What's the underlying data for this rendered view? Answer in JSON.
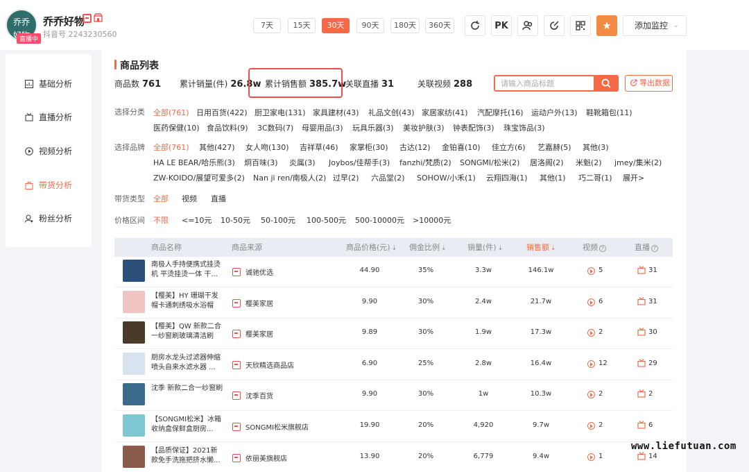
{
  "account": {
    "avatar_line1": "乔乔",
    "avatar_line2": "好物",
    "live_badge": "直播中",
    "name": "乔乔好物",
    "store_icon": "store-icon",
    "id_text": "抖音号 2243230560"
  },
  "time_ranges": [
    {
      "label": "7天",
      "active": false
    },
    {
      "label": "15天",
      "active": false
    },
    {
      "label": "30天",
      "active": true
    },
    {
      "label": "90天",
      "active": false
    },
    {
      "label": "180天",
      "active": false
    },
    {
      "label": "360天",
      "active": false
    }
  ],
  "toolbar": {
    "pk_label": "PK",
    "add_monitor_label": "添加监控",
    "icons": [
      "refresh-icon",
      "pk-icon",
      "users-icon",
      "edit-icon",
      "qrcode-icon",
      "star-icon"
    ]
  },
  "sidebar": {
    "items": [
      {
        "label": "基础分析",
        "icon": "chart-icon",
        "active": false
      },
      {
        "label": "直播分析",
        "icon": "live-icon",
        "active": false
      },
      {
        "label": "视频分析",
        "icon": "video-icon",
        "active": false
      },
      {
        "label": "带货分析",
        "icon": "bag-icon",
        "active": true
      },
      {
        "label": "粉丝分析",
        "icon": "fans-icon",
        "active": false
      }
    ]
  },
  "section": {
    "title": "商品列表"
  },
  "stats": {
    "product_count_label": "商品数",
    "product_count": "761",
    "sales_label": "累计销量(件)",
    "sales": "26.8w",
    "revenue_label": "累计销售额",
    "revenue": "385.7w",
    "live_label": "关联直播",
    "live": "31",
    "video_label": "关联视频",
    "video": "288"
  },
  "search": {
    "placeholder": "请输入商品标题"
  },
  "export_label": "导出数据",
  "filters": {
    "category_label": "选择分类",
    "categories_row1": [
      "全部(761)",
      "日用百货(422)",
      "厨卫家电(131)",
      "家具建材(43)",
      "礼品文创(43)",
      "家居家纺(41)",
      "汽配摩托(16)",
      "运动户外(13)",
      "鞋靴箱包(11)"
    ],
    "categories_row2": [
      "医药保健(10)",
      "食品饮料(9)",
      "3C数码(7)",
      "母婴用品(3)",
      "玩具乐器(3)",
      "美妆护肤(3)",
      "钟表配饰(3)",
      "珠宝饰品(3)"
    ],
    "brand_label": "选择品牌",
    "brands_row1": [
      "全部(761)",
      "其他(427)",
      "女人吻(130)",
      "吉祥草(46)",
      "家掌柜(30)",
      "古达(12)",
      "金铂喜(10)",
      "佳立方(6)",
      "艺嘉赫(5)",
      "其他(3)"
    ],
    "brands_row2": [
      "HA LE BEAR/哈乐熊(3)",
      "炯百味(3)",
      "炎属(3)",
      "Joybos/佳帮手(3)",
      "fanzhi/梵质(2)",
      "SONGMI/松米(2)",
      "居洛阁(2)",
      "米魁(2)",
      "jmey/集米(2)"
    ],
    "brands_row3": [
      "ZW-KOIDO/展望可爱多(2)",
      "Nan ji ren/南极人(2)",
      "过早(2)",
      "六品堂(2)",
      "SOHOW/小禾(1)",
      "云翔四海(1)",
      "其他(1)",
      "巧二哥(1)",
      "展开>"
    ],
    "type_label": "带货类型",
    "types": [
      "全部",
      "视频",
      "直播"
    ],
    "price_label": "价格区间",
    "prices": [
      "不限",
      "<=10元",
      "10-50元",
      "50-100元",
      "100-500元",
      "500-10000元",
      ">10000元"
    ]
  },
  "table": {
    "headers": [
      "商品名称",
      "商品来源",
      "商品价格(元)",
      "佣金比例",
      "销量(件)",
      "销售额",
      "视频",
      "直播"
    ],
    "rows": [
      {
        "name": "南极人手持便携式挂烫机 平烫挂烫一体 干...",
        "source": "诚驰优选",
        "price": "44.90",
        "commission": "35%",
        "sales": "3.3w",
        "revenue": "146.1w",
        "videos": "5",
        "lives": "31",
        "thumb_color": "#2c4f7a"
      },
      {
        "name": "【樱美】HY 珊瑚干发帽卡通刺绣吸水浴帽",
        "source": "樱美家居",
        "price": "9.90",
        "commission": "30%",
        "sales": "2.4w",
        "revenue": "21.7w",
        "videos": "6",
        "lives": "31",
        "thumb_color": "#f1c4c4"
      },
      {
        "name": "【樱美】QW 新款二合一纱窗刷玻璃清洁刷",
        "source": "樱美家居",
        "price": "9.89",
        "commission": "30%",
        "sales": "1.9w",
        "revenue": "17.3w",
        "videos": "2",
        "lives": "30",
        "thumb_color": "#4a3a2a"
      },
      {
        "name": "厨房水龙头过滤器伸缩喷头自来水滤水器 ...",
        "source": "天欣精选商品店",
        "price": "6.90",
        "commission": "25%",
        "sales": "2.8w",
        "revenue": "16.4w",
        "videos": "12",
        "lives": "29",
        "thumb_color": "#d9e3ef"
      },
      {
        "name": "沈季 新款二合一纱窗刷",
        "source": "沈季百货",
        "price": "9.90",
        "commission": "30%",
        "sales": "1w",
        "revenue": "10.3w",
        "videos": "2",
        "lives": "2",
        "thumb_color": "#3a6b8a"
      },
      {
        "name": "【SONGMI松米】冰箱收纳盒保鲜盒厨房...",
        "source": "SONGMI松米旗舰店",
        "price": "19.90",
        "commission": "20%",
        "sales": "4,920",
        "revenue": "9.7w",
        "videos": "2",
        "lives": "6",
        "thumb_color": "#7fc6d3"
      },
      {
        "name": "【品质保证】2021新款免手洗拖把挤水懒...",
        "source": "依丽美旗舰店",
        "price": "13.90",
        "commission": "20%",
        "sales": "6,779",
        "revenue": "9.4w",
        "videos": "1",
        "lives": "14",
        "thumb_color": "#8a5a4a"
      }
    ]
  },
  "watermark": "www.liefutuan.com",
  "colors": {
    "accent": "#f46a46",
    "highlight": "#ef4e4e",
    "header_bg": "#e9edf3"
  }
}
